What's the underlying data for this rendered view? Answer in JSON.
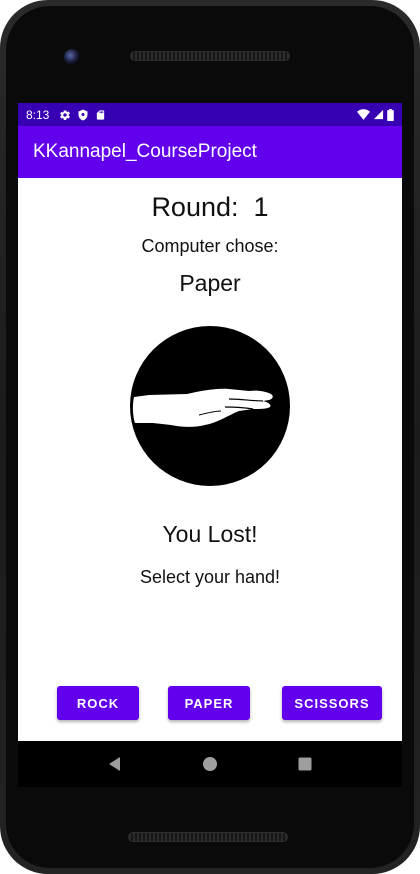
{
  "status_bar": {
    "time": "8:13",
    "icons_left": [
      "gear-icon",
      "shield-icon",
      "sd-card-icon"
    ],
    "icons_right": [
      "wifi-icon",
      "signal-icon",
      "battery-icon"
    ]
  },
  "app_bar": {
    "title": "KKannapel_CourseProject"
  },
  "game": {
    "round_label": "Round:",
    "round_number": "1",
    "computer_chose_label": "Computer chose:",
    "computer_choice": "Paper",
    "computer_choice_image": "paper-hand-icon",
    "result": "You Lost!",
    "prompt": "Select your hand!"
  },
  "buttons": {
    "rock": "ROCK",
    "paper": "PAPER",
    "scissors": "SCISSORS"
  },
  "navigation": {
    "items": [
      "back-icon",
      "home-icon",
      "recents-icon"
    ]
  },
  "colors": {
    "status_bar": "#3700b3",
    "primary": "#6200ee",
    "on_primary": "#ffffff"
  }
}
